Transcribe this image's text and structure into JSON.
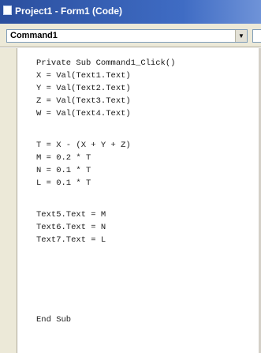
{
  "window": {
    "title": "Project1 - Form1 (Code)"
  },
  "object_combo": {
    "selected": "Command1"
  },
  "code": {
    "lines": [
      "Private Sub Command1_Click()",
      "X = Val(Text1.Text)",
      "Y = Val(Text2.Text)",
      "Z = Val(Text3.Text)",
      "W = Val(Text4.Text)",
      "T = X - (X + Y + Z)",
      "M = 0.2 * T",
      "N = 0.1 * T",
      "L = 0.1 * T",
      "Text5.Text = M",
      "Text6.Text = N",
      "Text7.Text = L",
      "End Sub"
    ]
  }
}
